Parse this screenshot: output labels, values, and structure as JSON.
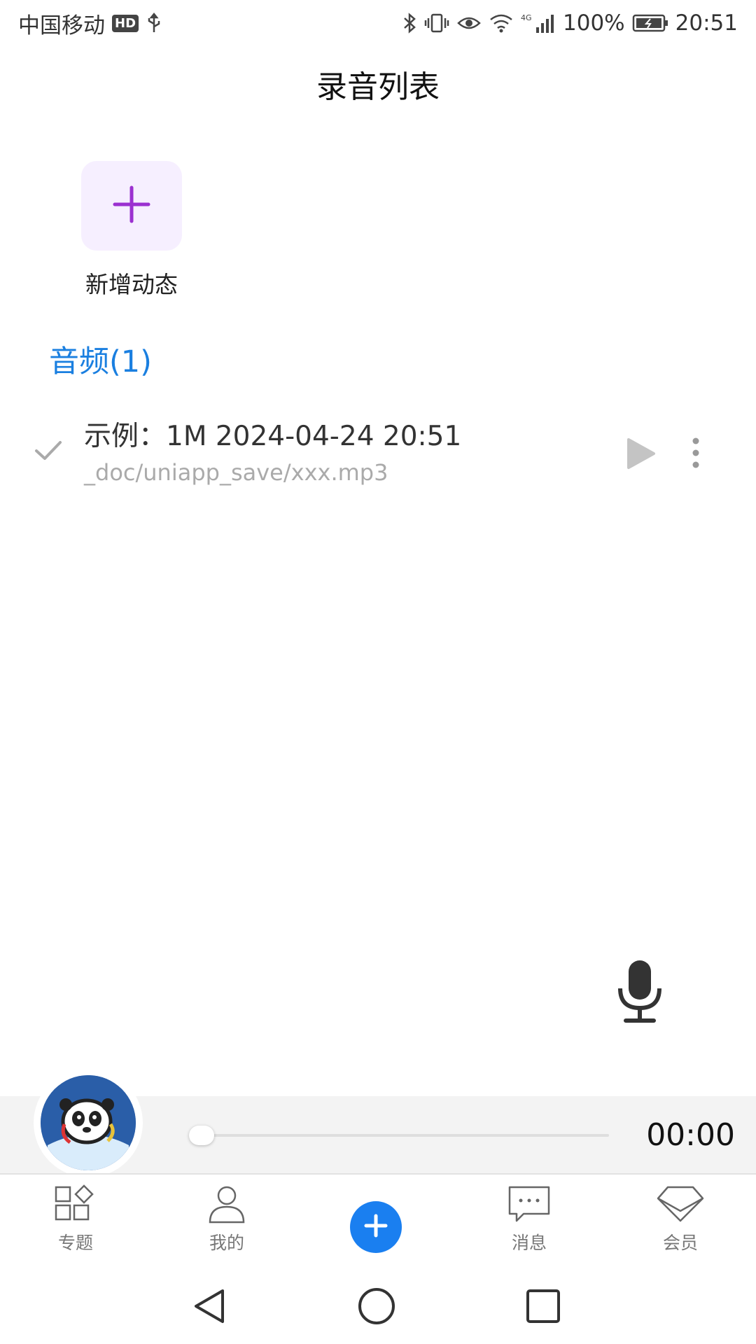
{
  "status_bar": {
    "carrier": "中国移动",
    "hd": "HD",
    "signal_label": "4G",
    "battery": "100%",
    "time": "20:51"
  },
  "header": {
    "title": "录音列表"
  },
  "add_tile": {
    "label": "新增动态",
    "icon": "plus-icon"
  },
  "section": {
    "heading": "音频(1)"
  },
  "recordings": [
    {
      "title": "示例：1M 2024-04-24 20:51",
      "path": "_doc/uniapp_save/xxx.mp3"
    }
  ],
  "player": {
    "time": "00:00",
    "progress": 0
  },
  "tabs": [
    {
      "label": "专题",
      "icon": "grid-icon"
    },
    {
      "label": "我的",
      "icon": "person-icon"
    },
    {
      "label": "",
      "icon": "plus-circle-icon"
    },
    {
      "label": "消息",
      "icon": "chat-icon"
    },
    {
      "label": "会员",
      "icon": "diamond-icon"
    }
  ],
  "colors": {
    "accent": "#1a7fe0",
    "plus_purple": "#9b30d0",
    "tile_bg": "#f6efff"
  }
}
